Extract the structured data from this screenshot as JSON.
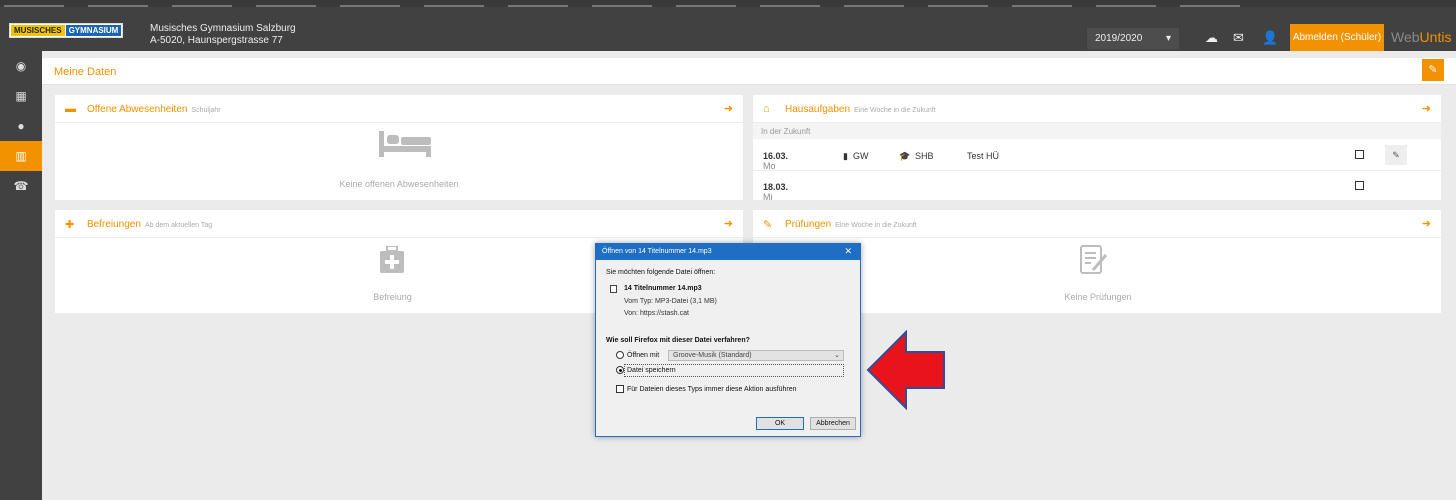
{
  "topbar": {
    "logo_part1": "MUSISCHES",
    "logo_part2": "GYMNASIUM",
    "school_name": "Musisches Gymnasium Salzburg",
    "school_address": "A-5020, Haunspergstrasse 77",
    "school_year": "2019/2020",
    "logout_label": "Abmelden (Schüler)",
    "brand_a": "Web",
    "brand_b": "Untis"
  },
  "page": {
    "title": "Meine Daten"
  },
  "panels": {
    "absences": {
      "title": "Offene Abwesenheiten",
      "subtitle": "Schuljahr",
      "empty": "Keine offenen Abwesenheiten"
    },
    "exemptions": {
      "title": "Befreiungen",
      "subtitle": "Ab dem aktuellen Tag",
      "empty": "Befreiung"
    },
    "homework": {
      "title": "Hausaufgaben",
      "subtitle": "Eine Woche in die Zukunft",
      "section": "In der Zukunft",
      "rows": [
        {
          "day": "Mo",
          "date": "16.03.",
          "subject": "GW",
          "teacher": "SHB",
          "text": "Test HÜ"
        },
        {
          "day": "Mi",
          "date": "18.03."
        }
      ]
    },
    "exams": {
      "title": "Prüfungen",
      "subtitle": "Eine Woche in die Zukunft",
      "empty": "Keine Prüfungen"
    }
  },
  "dialog": {
    "title": "Öffnen von 14 Titelnummer 14.mp3",
    "intro": "Sie möchten folgende Datei öffnen:",
    "filename": "14 Titelnummer 14.mp3",
    "filetype": "Vom Typ: MP3-Datei (3,1 MB)",
    "source": "Von: https://stash.cat",
    "question": "Wie soll Firefox mit dieser Datei verfahren?",
    "open_with_label": "Öffnen mit",
    "open_with_value": "Groove-Musik (Standard)",
    "save_label": "Datei speichern",
    "always_label": "Für Dateien dieses Typs immer diese Aktion ausführen",
    "ok_label": "OK",
    "cancel_label": "Abbrechen"
  },
  "colors": {
    "accent": "#f39200",
    "sidebar": "#414141",
    "dialog_blue": "#1e6fc4",
    "arrow_red": "#e8131b",
    "arrow_border": "#2e4d9b"
  },
  "icons": {
    "sidebar": [
      "dashboard-icon",
      "calendar-icon",
      "messages-icon",
      "book-icon",
      "contacts-icon"
    ]
  }
}
